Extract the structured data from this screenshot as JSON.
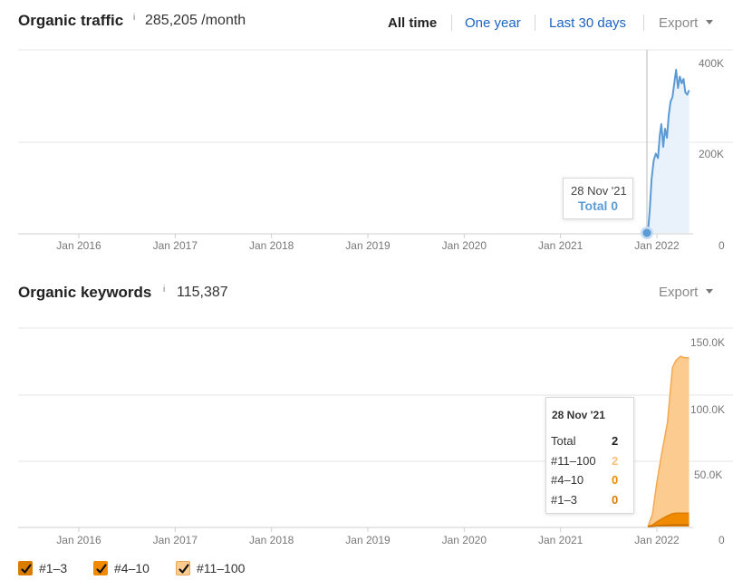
{
  "traffic": {
    "title": "Organic traffic",
    "info": "i",
    "value": "285,205 /month",
    "ranges": [
      "All time",
      "One year",
      "Last 30 days"
    ],
    "active_range": "All time",
    "export_label": "Export",
    "tooltip": {
      "date": "28 Nov '21",
      "total_label": "Total 0"
    }
  },
  "keywords": {
    "title": "Organic keywords",
    "info": "i",
    "value": "115,387",
    "export_label": "Export",
    "tooltip": {
      "date": "28 Nov '21",
      "rows": [
        {
          "label": "Total",
          "value": "2",
          "color": "#222222"
        },
        {
          "label": "#11–100",
          "value": "2",
          "color": "#fbbf78"
        },
        {
          "label": "#4–10",
          "value": "0",
          "color": "#f08a00"
        },
        {
          "label": "#1–3",
          "value": "0",
          "color": "#d97c00"
        }
      ]
    }
  },
  "legend": [
    {
      "label": "#1–3",
      "color": "#d97c00"
    },
    {
      "label": "#4–10",
      "color": "#f08a00"
    },
    {
      "label": "#11–100",
      "color": "#fbcb8f"
    }
  ],
  "colors": {
    "traffic_line": "#5b9bd5",
    "traffic_fill": "#e9f1fb",
    "kw_top3": "#d97c00",
    "kw_4_10": "#f08a00",
    "kw_11_100": "#fbcb8f"
  },
  "chart_data": [
    {
      "type": "area",
      "title": "Organic traffic",
      "x_ticks": [
        "Jan 2016",
        "Jan 2017",
        "Jan 2018",
        "Jan 2019",
        "Jan 2020",
        "Jan 2021",
        "Jan 2022"
      ],
      "y_ticks": [
        "400K",
        "200K",
        "0"
      ],
      "ylim": [
        0,
        400000
      ],
      "grid": true,
      "series": [
        {
          "x": [
            "2021-11-28",
            "2021-12-05",
            "2021-12-12",
            "2021-12-20",
            "2021-12-28",
            "2022-01-05",
            "2022-01-12",
            "2022-01-18",
            "2022-01-25",
            "2022-02-01",
            "2022-02-08",
            "2022-02-15",
            "2022-02-22",
            "2022-03-01",
            "2022-03-08",
            "2022-03-15",
            "2022-03-22",
            "2022-03-29",
            "2022-04-05",
            "2022-04-12",
            "2022-04-19",
            "2022-04-26",
            "2022-05-03"
          ],
          "y": [
            0,
            50000,
            120000,
            160000,
            175000,
            165000,
            215000,
            240000,
            190000,
            230000,
            210000,
            260000,
            290000,
            300000,
            330000,
            360000,
            320000,
            345000,
            330000,
            340000,
            310000,
            305000,
            315000
          ]
        }
      ]
    },
    {
      "type": "area",
      "title": "Organic keywords",
      "x_ticks": [
        "Jan 2016",
        "Jan 2017",
        "Jan 2018",
        "Jan 2019",
        "Jan 2020",
        "Jan 2021",
        "Jan 2022"
      ],
      "y_ticks": [
        "150.0K",
        "100.0K",
        "50.0K",
        "0"
      ],
      "ylim": [
        0,
        150000
      ],
      "grid": true,
      "x": [
        "2021-11-28",
        "2021-12-15",
        "2022-01-01",
        "2022-01-20",
        "2022-02-10",
        "2022-03-01",
        "2022-03-15",
        "2022-04-01",
        "2022-04-15",
        "2022-05-03"
      ],
      "series": [
        {
          "name": "#11–100",
          "values": [
            2,
            8000,
            30000,
            50000,
            70000,
            110000,
            115000,
            118000,
            117000,
            117000
          ]
        },
        {
          "name": "#4–10",
          "values": [
            0,
            1000,
            3000,
            5000,
            7000,
            8500,
            8800,
            8800,
            8700,
            8700
          ]
        },
        {
          "name": "#1–3",
          "values": [
            0,
            200,
            500,
            800,
            1000,
            1200,
            1300,
            1300,
            1300,
            1300
          ]
        }
      ]
    }
  ]
}
